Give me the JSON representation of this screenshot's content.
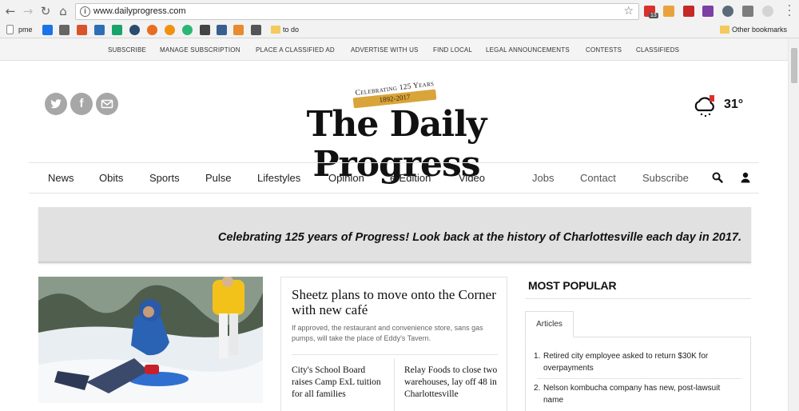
{
  "browser": {
    "url": "www.dailyprogress.com",
    "ext_badge": "13",
    "bookmarks": [
      "pme",
      "to do"
    ],
    "other_bookmarks": "Other bookmarks"
  },
  "utility_nav": [
    "SUBSCRIBE",
    "MANAGE SUBSCRIPTION",
    "PLACE A CLASSIFIED AD",
    "ADVERTISE WITH US",
    "FIND LOCAL",
    "LEGAL ANNOUNCEMENTS",
    "CONTESTS",
    "CLASSIFIEDS"
  ],
  "masthead": {
    "celebrating": "Celebrating 125 Years",
    "years": "1892-2017",
    "logo": "The Daily Progress"
  },
  "weather": {
    "temperature": "31°"
  },
  "main_nav": [
    "News",
    "Obits",
    "Sports",
    "Pulse",
    "Lifestyles",
    "Opinion",
    "e-Edition",
    "Video"
  ],
  "secondary_nav": [
    "Jobs",
    "Contact",
    "Subscribe"
  ],
  "banner": "Celebrating 125 years of Progress! Look back at the history of Charlottesville each day in 2017.",
  "lead_story": {
    "headline": "Sheetz plans to move onto the Corner with new café",
    "summary": "If approved, the restaurant and convenience store, sans gas pumps, will take the place of Eddy's Tavern."
  },
  "sub_stories": [
    "City's School Board raises Camp ExL tuition for all families",
    "Relay Foods to close two warehouses, lay off 48 in Charlottesville"
  ],
  "most_popular": {
    "title": "MOST POPULAR",
    "tab": "Articles",
    "items": [
      {
        "num": "1.",
        "text": "Retired city employee asked to return $30K for overpayments"
      },
      {
        "num": "2.",
        "text": "Nelson kombucha company has new, post-lawsuit name"
      }
    ]
  }
}
